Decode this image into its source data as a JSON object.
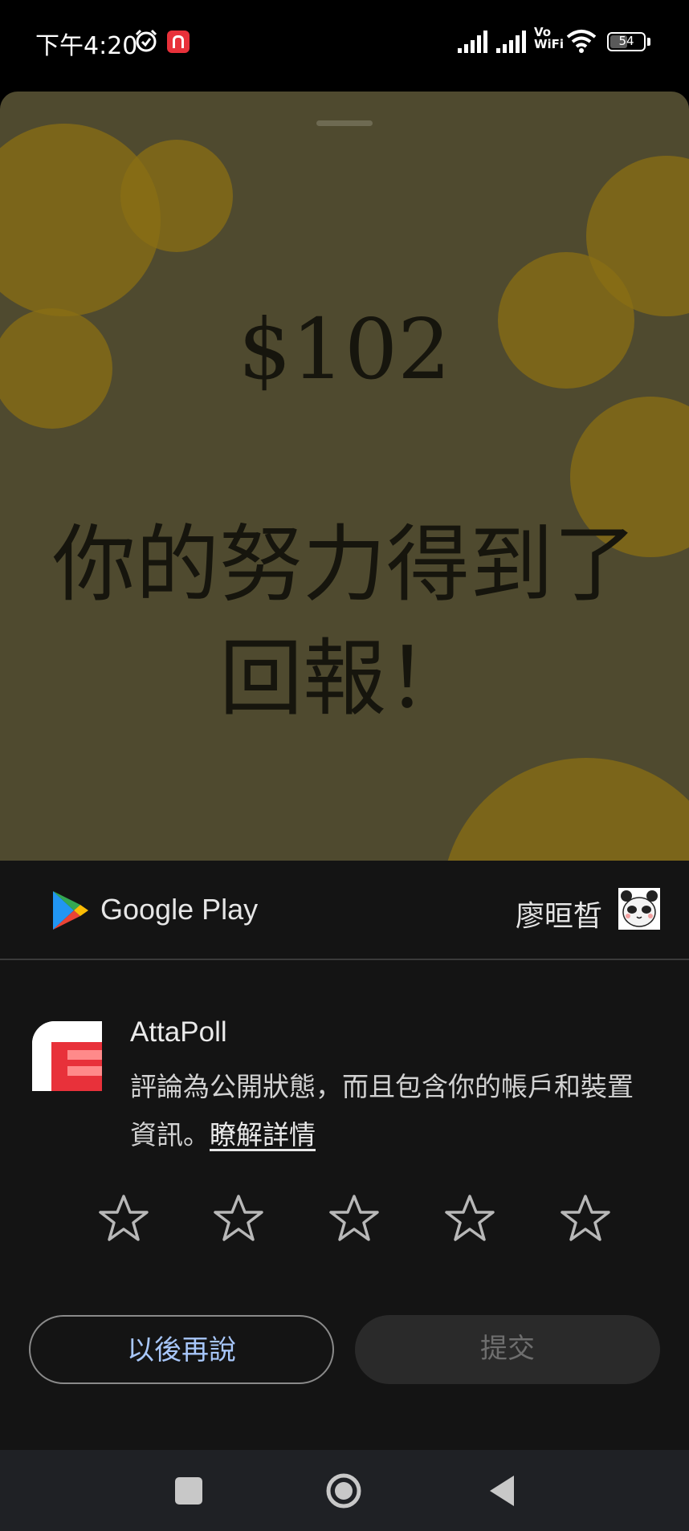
{
  "status_bar": {
    "time": "下午4:20",
    "vowifi_top": "Vo",
    "vowifi_bottom": "WiFi",
    "battery": "54",
    "battery_level": 0.54
  },
  "reward": {
    "amount": "$102",
    "headline": "你的努力得到了回報！"
  },
  "store_bar": {
    "logo_text": "Google Play",
    "user_name": "廖晅晳"
  },
  "review": {
    "app_name": "AttaPoll",
    "notice": "評論為公開狀態，而且包含你的帳戶和裝置資訊。",
    "learn_more": "瞭解詳情",
    "star_count": 5,
    "later_label": "以後再說",
    "submit_label": "提交"
  },
  "colors": {
    "accent_blue": "#a8c7fa",
    "sheet_bg": "#141414",
    "brand_red": "#e8313a"
  }
}
